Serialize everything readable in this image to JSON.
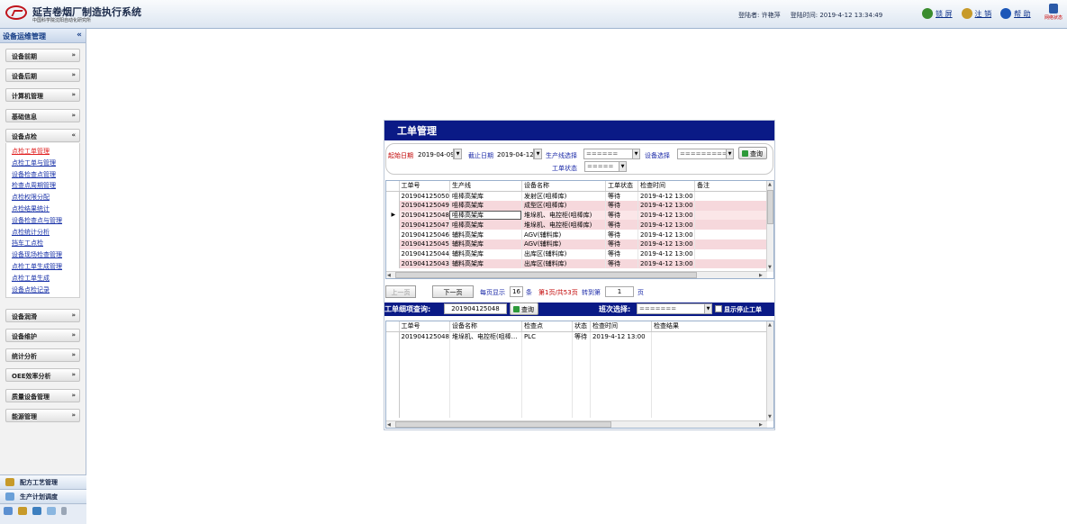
{
  "header": {
    "title": "延吉卷烟厂制造执行系统",
    "subtitle": "中国科学院沈阳自动化研究所",
    "login_user": "登陆者: 许艳萍",
    "login_time": "登陆时间: 2019-4-12 13:34:49",
    "buttons": [
      {
        "label": "锁 屏",
        "icon": "lock-screen-icon",
        "color": "#3a8c2e"
      },
      {
        "label": "注 销",
        "icon": "logout-icon",
        "color": "#c79a2a"
      },
      {
        "label": "帮 助",
        "icon": "help-icon",
        "color": "#1b56b8"
      }
    ],
    "network_status": "网络状态"
  },
  "sidebar": {
    "title": "设备运维管理",
    "collapse": "«",
    "groups_top": [
      "设备前期",
      "设备后期",
      "计算机管理",
      "基础信息",
      "设备点检"
    ],
    "sub_items": [
      "点检工单管理",
      "点检工单与管理",
      "设备检查点管理",
      "检查点周期管理",
      "点检权限分配",
      "点检结果统计",
      "设备检查点与管理",
      "点检统计分析",
      "挡车工点检",
      "设备现场检查管理",
      "点检工单生成管理",
      "点检工单生成",
      "设备点检记录"
    ],
    "groups_bottom": [
      "设备润滑",
      "设备维护",
      "统计分析",
      "OEE效率分析",
      "质量设备管理",
      "能源管理"
    ],
    "bottom_nav": [
      "配方工艺管理",
      "生产计划调度"
    ]
  },
  "panel": {
    "title": "工单管理",
    "filters": {
      "start_label": "起始日期",
      "start_value": "2019-04-09",
      "end_label": "截止日期",
      "end_value": "2019-04-12",
      "line_label": "生产线选择",
      "line_value": "======",
      "device_label": "设备选择",
      "device_value": "===========",
      "status_label": "工单状态",
      "status_value": "=====",
      "query": "查询"
    },
    "grid": {
      "columns": [
        "工单号",
        "生产线",
        "设备名称",
        "工单状态",
        "检查时间",
        "备注"
      ],
      "rows": [
        [
          "201904125050",
          "咀棒高架库",
          "发射区(咀棒库)",
          "等待",
          "2019-4-12 13:00",
          ""
        ],
        [
          "201904125049",
          "咀棒高架库",
          "成型区(咀棒库)",
          "等待",
          "2019-4-12 13:00",
          ""
        ],
        [
          "201904125048",
          "咀棒高架库",
          "堆垛机、电控柜(咀棒库)",
          "等待",
          "2019-4-12 13:00",
          ""
        ],
        [
          "201904125047",
          "咀棒高架库",
          "堆垛机、电控柜(咀棒库)",
          "等待",
          "2019-4-12 13:00",
          ""
        ],
        [
          "201904125046",
          "辅料高架库",
          "AGV(辅料库)",
          "等待",
          "2019-4-12 13:00",
          ""
        ],
        [
          "201904125045",
          "辅料高架库",
          "AGV(辅料库)",
          "等待",
          "2019-4-12 13:00",
          ""
        ],
        [
          "201904125044",
          "辅料高架库",
          "出库区(辅料库)",
          "等待",
          "2019-4-12 13:00",
          ""
        ],
        [
          "201904125043",
          "辅料高架库",
          "出库区(辅料库)",
          "等待",
          "2019-4-12 13:00",
          ""
        ]
      ],
      "selected_marker": "▶"
    },
    "pager": {
      "prev": "上一页",
      "next": "下一页",
      "per_page_label": "每页显示",
      "per_page_value": "16",
      "per_page_unit": "条",
      "page_info": "第1页/共53页",
      "goto_label": "转到第",
      "goto_value": "1",
      "goto_unit": "页"
    },
    "detail": {
      "query_label": "工单细项查询:",
      "query_value": "201904125048",
      "query_button": "查询",
      "shift_label": "班次选择:",
      "shift_value": "=======",
      "show_stopped": "显示停止工单",
      "columns": [
        "工单号",
        "设备名称",
        "检查点",
        "状态",
        "检查时间",
        "检查结果"
      ],
      "rows": [
        [
          "201904125048",
          "堆垛机、电控柜(咀棒…",
          "PLC",
          "等待",
          "2019-4-12 13:00",
          ""
        ]
      ]
    }
  },
  "colors": {
    "title_bar": "#0a1a86",
    "row_alt": "#f6d8dc",
    "link": "#1932a8",
    "active_link": "#e02020"
  }
}
